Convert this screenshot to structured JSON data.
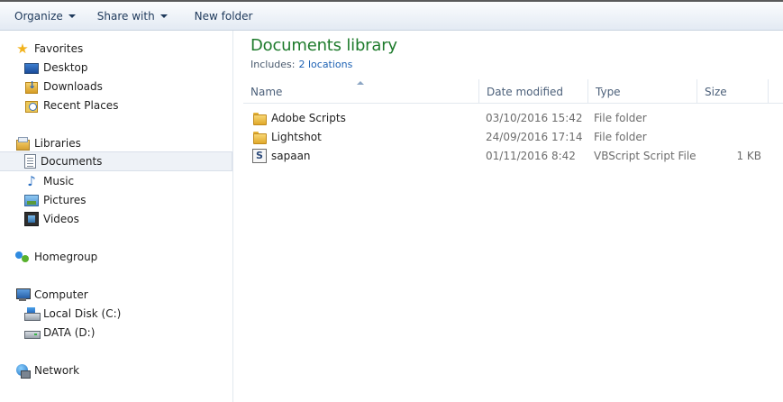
{
  "toolbar": {
    "organize_label": "Organize",
    "share_label": "Share with",
    "new_folder_label": "New folder"
  },
  "nav": {
    "favorites": {
      "label": "Favorites",
      "items": [
        {
          "label": "Desktop",
          "icon": "desktop-icon"
        },
        {
          "label": "Downloads",
          "icon": "downloads-icon"
        },
        {
          "label": "Recent Places",
          "icon": "recent-places-icon"
        }
      ]
    },
    "libraries": {
      "label": "Libraries",
      "items": [
        {
          "label": "Documents",
          "icon": "documents-icon",
          "selected": true
        },
        {
          "label": "Music",
          "icon": "music-icon"
        },
        {
          "label": "Pictures",
          "icon": "pictures-icon"
        },
        {
          "label": "Videos",
          "icon": "videos-icon"
        }
      ]
    },
    "homegroup": {
      "label": "Homegroup"
    },
    "computer": {
      "label": "Computer",
      "items": [
        {
          "label": "Local Disk (C:)",
          "icon": "local-disk-icon"
        },
        {
          "label": "DATA (D:)",
          "icon": "data-drive-icon"
        }
      ]
    },
    "network": {
      "label": "Network"
    }
  },
  "library": {
    "title": "Documents library",
    "includes_label": "Includes:",
    "locations_link": "2 locations"
  },
  "columns": {
    "name": "Name",
    "date_modified": "Date modified",
    "type": "Type",
    "size": "Size"
  },
  "files": [
    {
      "name": "Adobe Scripts",
      "date": "03/10/2016 15:42",
      "type": "File folder",
      "size": "",
      "icon": "folder-icon"
    },
    {
      "name": "Lightshot",
      "date": "24/09/2016 17:14",
      "type": "File folder",
      "size": "",
      "icon": "folder-icon"
    },
    {
      "name": "sapaan",
      "date": "01/11/2016 8:42",
      "type": "VBScript Script File",
      "size": "1 KB",
      "icon": "vbscript-file-icon"
    }
  ],
  "colors": {
    "title_green": "#1e7b2c",
    "link_blue": "#1e62b4",
    "toolbar_text": "#1e395b",
    "selection_bg": "#eef2f7"
  }
}
